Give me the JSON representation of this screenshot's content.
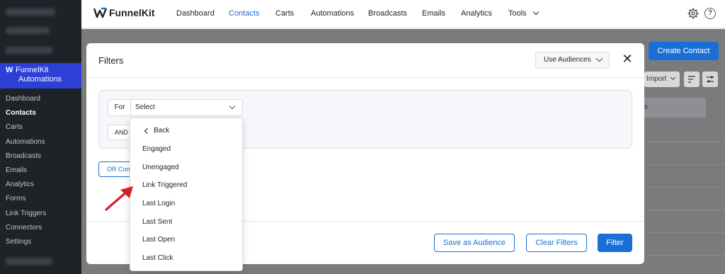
{
  "sidebar": {
    "brand_line1": "FunnelKit",
    "brand_line2": "Automations",
    "items": [
      {
        "label": "Dashboard",
        "active": false
      },
      {
        "label": "Contacts",
        "active": true
      },
      {
        "label": "Carts",
        "active": false
      },
      {
        "label": "Automations",
        "active": false
      },
      {
        "label": "Broadcasts",
        "active": false
      },
      {
        "label": "Emails",
        "active": false
      },
      {
        "label": "Analytics",
        "active": false
      },
      {
        "label": "Forms",
        "active": false
      },
      {
        "label": "Link Triggers",
        "active": false
      },
      {
        "label": "Connectors",
        "active": false
      },
      {
        "label": "Settings",
        "active": false
      }
    ]
  },
  "topnav": {
    "logo": "FunnelKit",
    "links": [
      {
        "label": "Dashboard"
      },
      {
        "label": "Contacts",
        "active": true
      },
      {
        "label": "Carts"
      },
      {
        "label": "Automations"
      },
      {
        "label": "Broadcasts"
      },
      {
        "label": "Emails"
      },
      {
        "label": "Analytics"
      },
      {
        "label": "Tools"
      }
    ]
  },
  "page": {
    "create_contact_label": "Create Contact",
    "import_label": "Import",
    "table_header_partial": "s"
  },
  "modal": {
    "title": "Filters",
    "use_audiences_label": "Use Audiences",
    "close_icon": "close-icon",
    "for_label": "For",
    "select_value": "Select",
    "and_label": "AND C",
    "or_label": "OR Con",
    "save_audience_label": "Save as Audience",
    "clear_filters_label": "Clear Filters",
    "filter_label": "Filter"
  },
  "dropdown": {
    "back_label": "Back",
    "options": [
      "Engaged",
      "Unengaged",
      "Link Triggered",
      "Last Login",
      "Last Sent",
      "Last Open",
      "Last Click"
    ]
  },
  "colors": {
    "accent": "#1a6fd6",
    "sidebar_bg": "#1d2327",
    "sidebar_brand": "#2c3fd6",
    "annotation": "#d0202a"
  }
}
